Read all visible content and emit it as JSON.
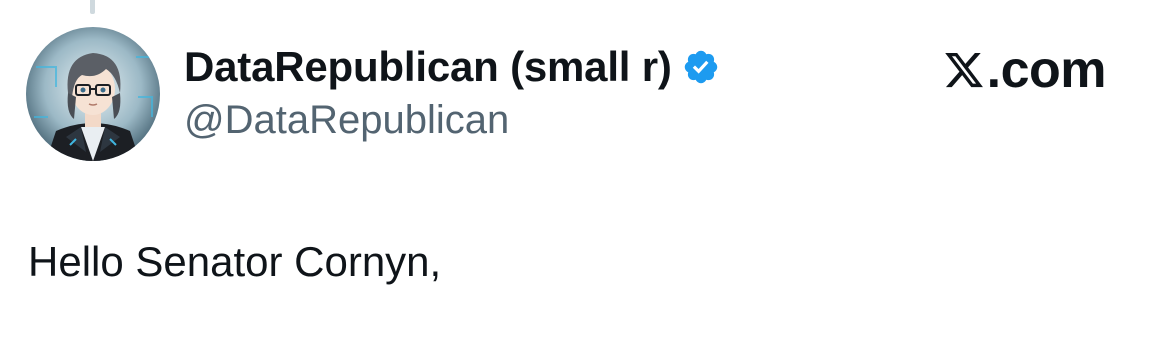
{
  "author": {
    "display_name": "DataRepublican (small r)",
    "handle": "@DataRepublican",
    "verified": true,
    "avatar_icon": "avatar-anime-portrait-icon"
  },
  "brand": {
    "logo_icon": "x-logo-icon",
    "text": ".com"
  },
  "tweet": {
    "text": "Hello Senator Cornyn,"
  },
  "colors": {
    "verified_blue": "#1d9bf0",
    "handle_gray": "#536471",
    "text_dark": "#0f1419"
  }
}
